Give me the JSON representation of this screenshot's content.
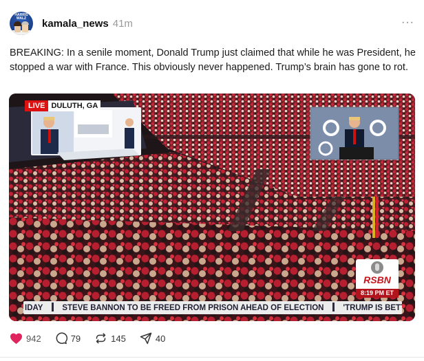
{
  "post": {
    "username": "kamala_news",
    "time": "41m",
    "more_label": "···",
    "avatar_text": "HARRIS WALZ",
    "text": "BREAKING: In a senile moment, Donald Trump just claimed that while he was President, he stopped a war with France. This obviously never happened. Trump’s brain has gone to rot."
  },
  "media": {
    "live_label": "LIVE",
    "location": "DULUTH, GA",
    "network": "RSBN",
    "clock": "8:19 PM ET",
    "ticker_segments": [
      "IDAY",
      "STEVE BANNON TO BE FREED FROM PRISON AHEAD OF ELECTION",
      "'TRUMP IS BETTER': A"
    ]
  },
  "actions": {
    "likes": "942",
    "comments": "79",
    "reposts": "145",
    "shares": "40"
  },
  "colors": {
    "like_heart": "#e0245e",
    "live_red": "#dd1111",
    "crowd_red": "#b3202b"
  }
}
